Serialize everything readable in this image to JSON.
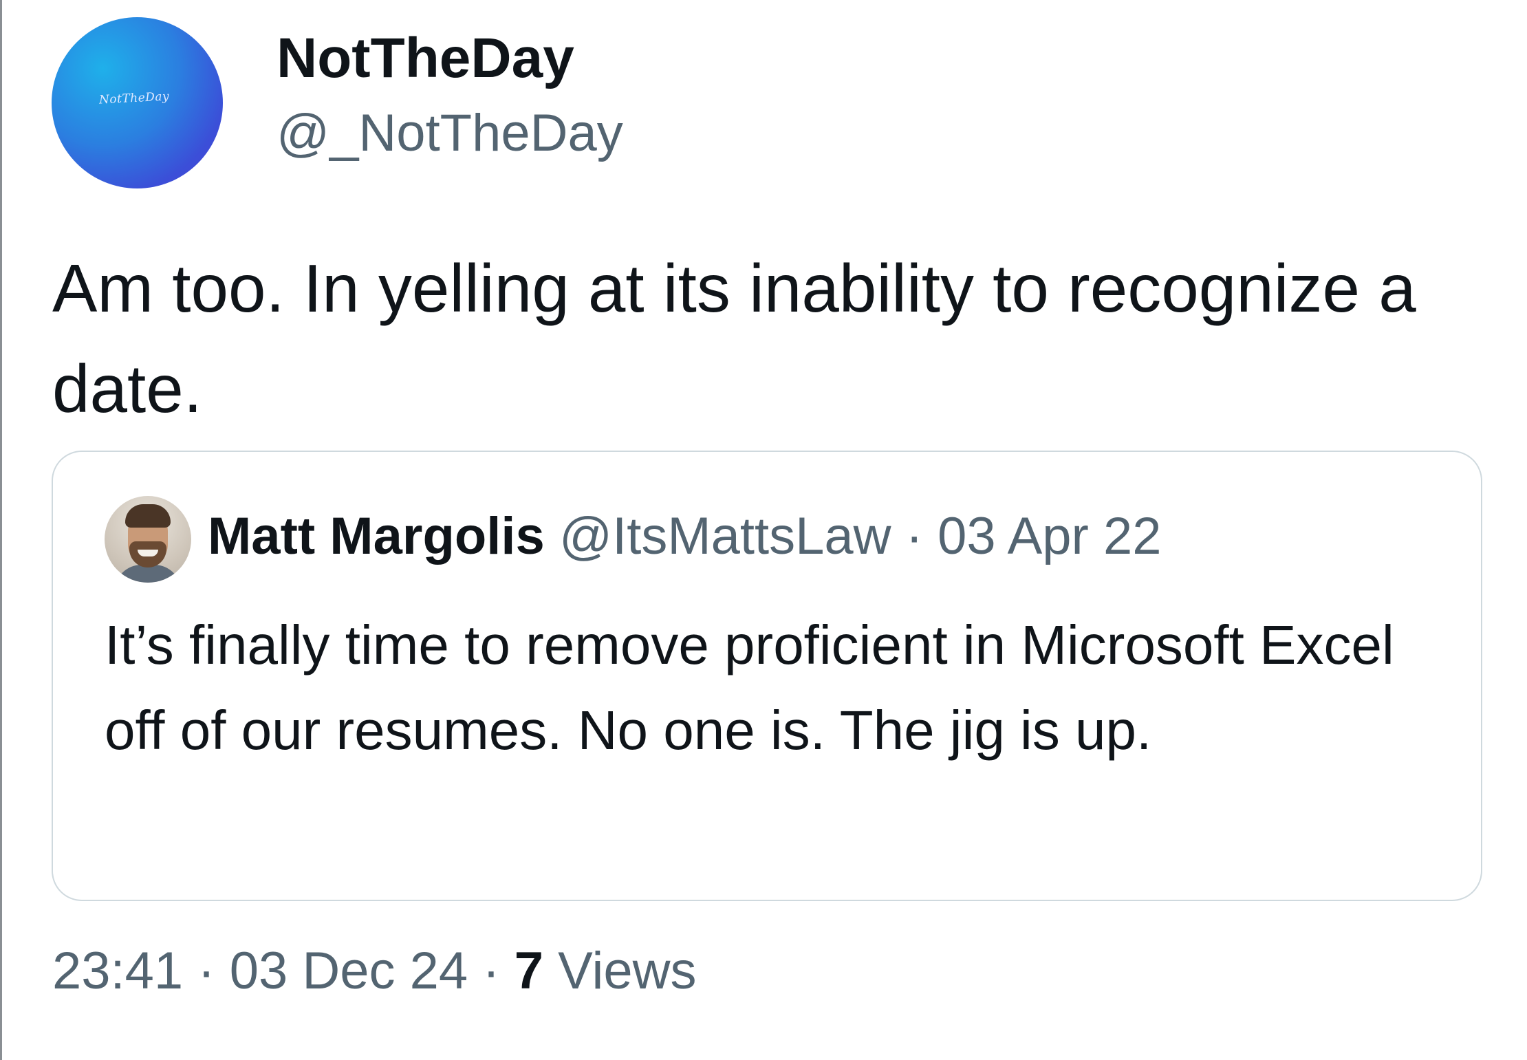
{
  "author": {
    "avatar_logo_text": "NotTheDay",
    "display_name": "NotTheDay",
    "handle": "@_NotTheDay"
  },
  "tweet": {
    "text": "Am too. In yelling at its inability to recognize a date."
  },
  "quoted_tweet": {
    "display_name": "Matt Margolis",
    "handle": "@ItsMattsLaw",
    "separator": "·",
    "date": "03 Apr 22",
    "text": "It’s finally time to remove proficient in Microsoft Excel off of our resumes. No one is. The jig is up."
  },
  "meta": {
    "time": "23:41",
    "separator": "·",
    "date": "03 Dec 24",
    "views_count": "7",
    "views_label": "Views"
  },
  "colors": {
    "text_primary": "#0f1419",
    "text_secondary": "#536471",
    "card_border": "#cfd9de"
  }
}
